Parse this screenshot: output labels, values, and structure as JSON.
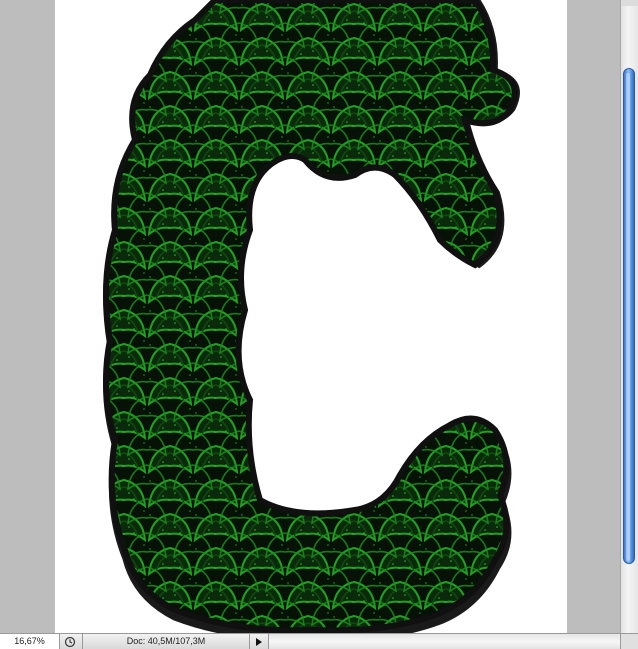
{
  "statusbar": {
    "zoom": "16,67%",
    "doc_info": "Doc: 40,5M/107,3M"
  },
  "icons": {
    "status_button": "clock-cycle-icon",
    "menu_arrow": "triangle-right-icon"
  },
  "colors": {
    "pasteboard": "#bdbdbd",
    "document_bg": "#ffffff",
    "letter_fill": "#071407",
    "letter_outline": "#1a1a1a",
    "pattern_stroke": "#1f8f1f",
    "scroll_thumb": "#5d98e6"
  },
  "vertical_scroll_position": 0.1
}
